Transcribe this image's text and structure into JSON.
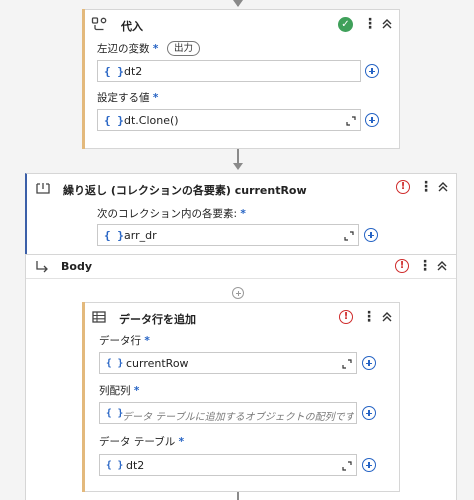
{
  "assign": {
    "title": "代入",
    "left_label": "左辺の変数",
    "required_mark": "*",
    "output_pill": "出力",
    "left_value": "dt2",
    "value_label": "設定する値",
    "value_value": "dt.Clone()",
    "status": "valid"
  },
  "foreach": {
    "title": "繰り返し (コレクションの各要素) currentRow",
    "collection_label": "次のコレクション内の各要素:",
    "required_mark": "*",
    "collection_value": "arr_dr",
    "status": "error"
  },
  "body": {
    "title": "Body",
    "status": "error"
  },
  "add_row": {
    "title": "データ行を追加",
    "status": "error",
    "datarow_label": "データ行",
    "datarow_value": "currentRow",
    "array_label": "列配列",
    "array_placeholder": "データ テーブルに追加するオブジェクトの配列です",
    "table_label": "データ テーブル",
    "table_value": "dt2",
    "required_mark": "*"
  },
  "icons": {
    "braces": "{ }",
    "kebab": "⋮",
    "error": "!",
    "check": "✓"
  },
  "colors": {
    "accent_blue": "#2563c4",
    "error_red": "#cf2b2b",
    "ok_green": "#3fa05a",
    "activity_accent": "#e3b97c"
  }
}
